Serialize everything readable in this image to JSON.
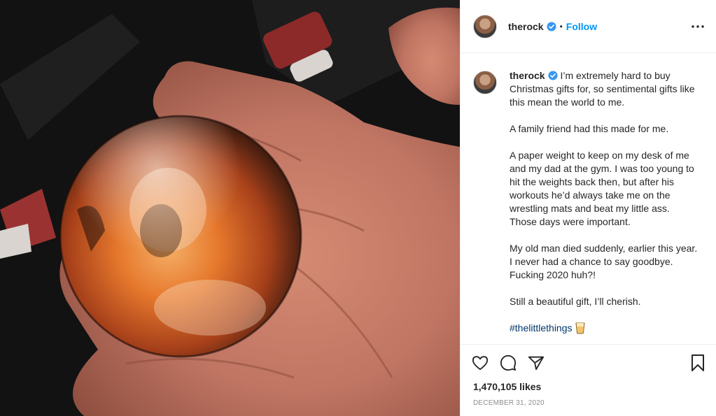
{
  "post": {
    "username": "therock",
    "follow_label": "Follow",
    "separator": "•",
    "image": {
      "subject": "hand-holding-glass-photo-paperweight"
    },
    "caption": {
      "username": "therock",
      "paragraphs": [
        "I’m extremely hard to buy Christmas gifts for, so sentimental gifts like this mean the world to me.",
        "A family friend had this made for me.",
        "A paper weight to keep on my desk of me and my dad at the gym. I was too young to hit the weights back then, but after his workouts he’d always take me on the wrestling mats and beat my little ass. Those days were important.",
        "My old man died suddenly, earlier this year. I never had a chance to say goodbye. Fucking 2020 huh?!",
        "Still a beautiful gift, I’ll cherish."
      ],
      "hashtag": "#thelittlethings",
      "hashtag_emoji": "tumbler-glass-icon"
    },
    "likes": "1,470,105 likes",
    "date": "December 31, 2020",
    "icons": {
      "header": [
        "verified-badge-icon",
        "more-options-icon"
      ],
      "actions": [
        "heart-icon",
        "comment-icon",
        "share-icon",
        "bookmark-icon"
      ]
    },
    "colors": {
      "follow": "#0095f6",
      "hashtag": "#00376b",
      "verified": "#3897f0",
      "text": "#262626",
      "muted": "#8e8e8e",
      "border": "#efefef"
    }
  }
}
